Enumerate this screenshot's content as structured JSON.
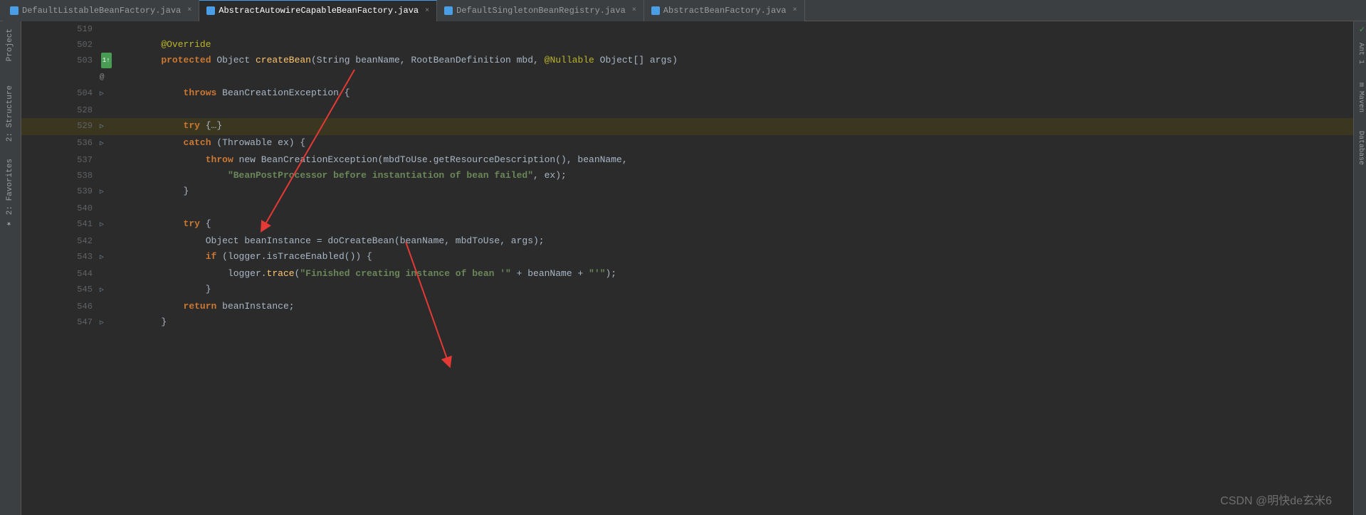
{
  "tabs": [
    {
      "label": "DefaultListableBeanFactory.java",
      "active": false,
      "id": "tab1"
    },
    {
      "label": "AbstractAutowireCapableBeanFactory.java",
      "active": true,
      "id": "tab2"
    },
    {
      "label": "DefaultSingletonBeanRegistry.java",
      "active": false,
      "id": "tab3"
    },
    {
      "label": "AbstractBeanFactory.java",
      "active": false,
      "id": "tab4"
    }
  ],
  "side_tabs_right": [
    "Ant 1",
    "Maven",
    "Database",
    "Structure: 2",
    "2: Favorites"
  ],
  "lines": [
    {
      "num": "519",
      "gutter": "",
      "indent": 0,
      "tokens": []
    },
    {
      "num": "502",
      "gutter": "",
      "indent": 2,
      "tokens": [
        {
          "t": "annotation",
          "v": "@Override"
        }
      ]
    },
    {
      "num": "503",
      "gutter": "1↑ @",
      "indent": 2,
      "tokens": [
        {
          "t": "kw",
          "v": "protected"
        },
        {
          "t": "type",
          "v": " Object "
        },
        {
          "t": "method",
          "v": "createBean"
        },
        {
          "t": "type",
          "v": "(String beanName, RootBeanDefinition mbd, "
        },
        {
          "t": "annotation",
          "v": "@Nullable"
        },
        {
          "t": "type",
          "v": " Object[] args)"
        }
      ]
    },
    {
      "num": "504",
      "gutter": "▷",
      "indent": 3,
      "tokens": [
        {
          "t": "kw",
          "v": "throws"
        },
        {
          "t": "type",
          "v": " BeanCreationException {"
        }
      ]
    },
    {
      "num": "528",
      "gutter": "",
      "indent": 0,
      "tokens": []
    },
    {
      "num": "529",
      "gutter": "▷",
      "indent": 3,
      "tokens": [
        {
          "t": "kw",
          "v": "try"
        },
        {
          "t": "type",
          "v": " {…}"
        }
      ],
      "highlighted": true
    },
    {
      "num": "536",
      "gutter": "▷",
      "indent": 3,
      "tokens": [
        {
          "t": "kw",
          "v": "catch"
        },
        {
          "t": "type",
          "v": " (Throwable ex) {"
        }
      ]
    },
    {
      "num": "537",
      "gutter": "",
      "indent": 4,
      "tokens": [
        {
          "t": "kw",
          "v": "throw"
        },
        {
          "t": "type",
          "v": " new BeanCreationException(mbdToUse.getResourceDescription(), beanName,"
        }
      ]
    },
    {
      "num": "538",
      "gutter": "",
      "indent": 5,
      "tokens": [
        {
          "t": "string",
          "v": "\"BeanPostProcessor before instantiation of bean failed\""
        },
        {
          "t": "type",
          "v": ", ex);"
        }
      ]
    },
    {
      "num": "539",
      "gutter": "▷",
      "indent": 3,
      "tokens": [
        {
          "t": "type",
          "v": "}"
        }
      ]
    },
    {
      "num": "540",
      "gutter": "",
      "indent": 0,
      "tokens": []
    },
    {
      "num": "541",
      "gutter": "▷",
      "indent": 3,
      "tokens": [
        {
          "t": "kw",
          "v": "try"
        },
        {
          "t": "type",
          "v": " {"
        }
      ]
    },
    {
      "num": "542",
      "gutter": "",
      "indent": 4,
      "tokens": [
        {
          "t": "type",
          "v": "Object beanInstance = doCreateBean(beanName, mbdToUse, args);"
        }
      ]
    },
    {
      "num": "543",
      "gutter": "▷",
      "indent": 4,
      "tokens": [
        {
          "t": "kw",
          "v": "if"
        },
        {
          "t": "type",
          "v": " (logger.isTraceEnabled()) {"
        }
      ]
    },
    {
      "num": "544",
      "gutter": "",
      "indent": 5,
      "tokens": [
        {
          "t": "type",
          "v": "logger."
        },
        {
          "t": "method",
          "v": "trace"
        },
        {
          "t": "type",
          "v": "("
        },
        {
          "t": "string",
          "v": "\"Finished creating instance of bean '\""
        },
        {
          "t": "type",
          "v": " + beanName + "
        },
        {
          "t": "string",
          "v": "\"'\""
        },
        {
          "t": "type",
          "v": ");"
        }
      ]
    },
    {
      "num": "545",
      "gutter": "▷",
      "indent": 4,
      "tokens": [
        {
          "t": "type",
          "v": "}"
        }
      ]
    },
    {
      "num": "546",
      "gutter": "",
      "indent": 3,
      "tokens": [
        {
          "t": "kw",
          "v": "return"
        },
        {
          "t": "type",
          "v": " beanInstance;"
        }
      ]
    },
    {
      "num": "547",
      "gutter": "▷",
      "indent": 2,
      "tokens": [
        {
          "t": "type",
          "v": "}"
        }
      ]
    }
  ],
  "watermark": "CSDN @明快de玄米6",
  "indent_size": 22
}
